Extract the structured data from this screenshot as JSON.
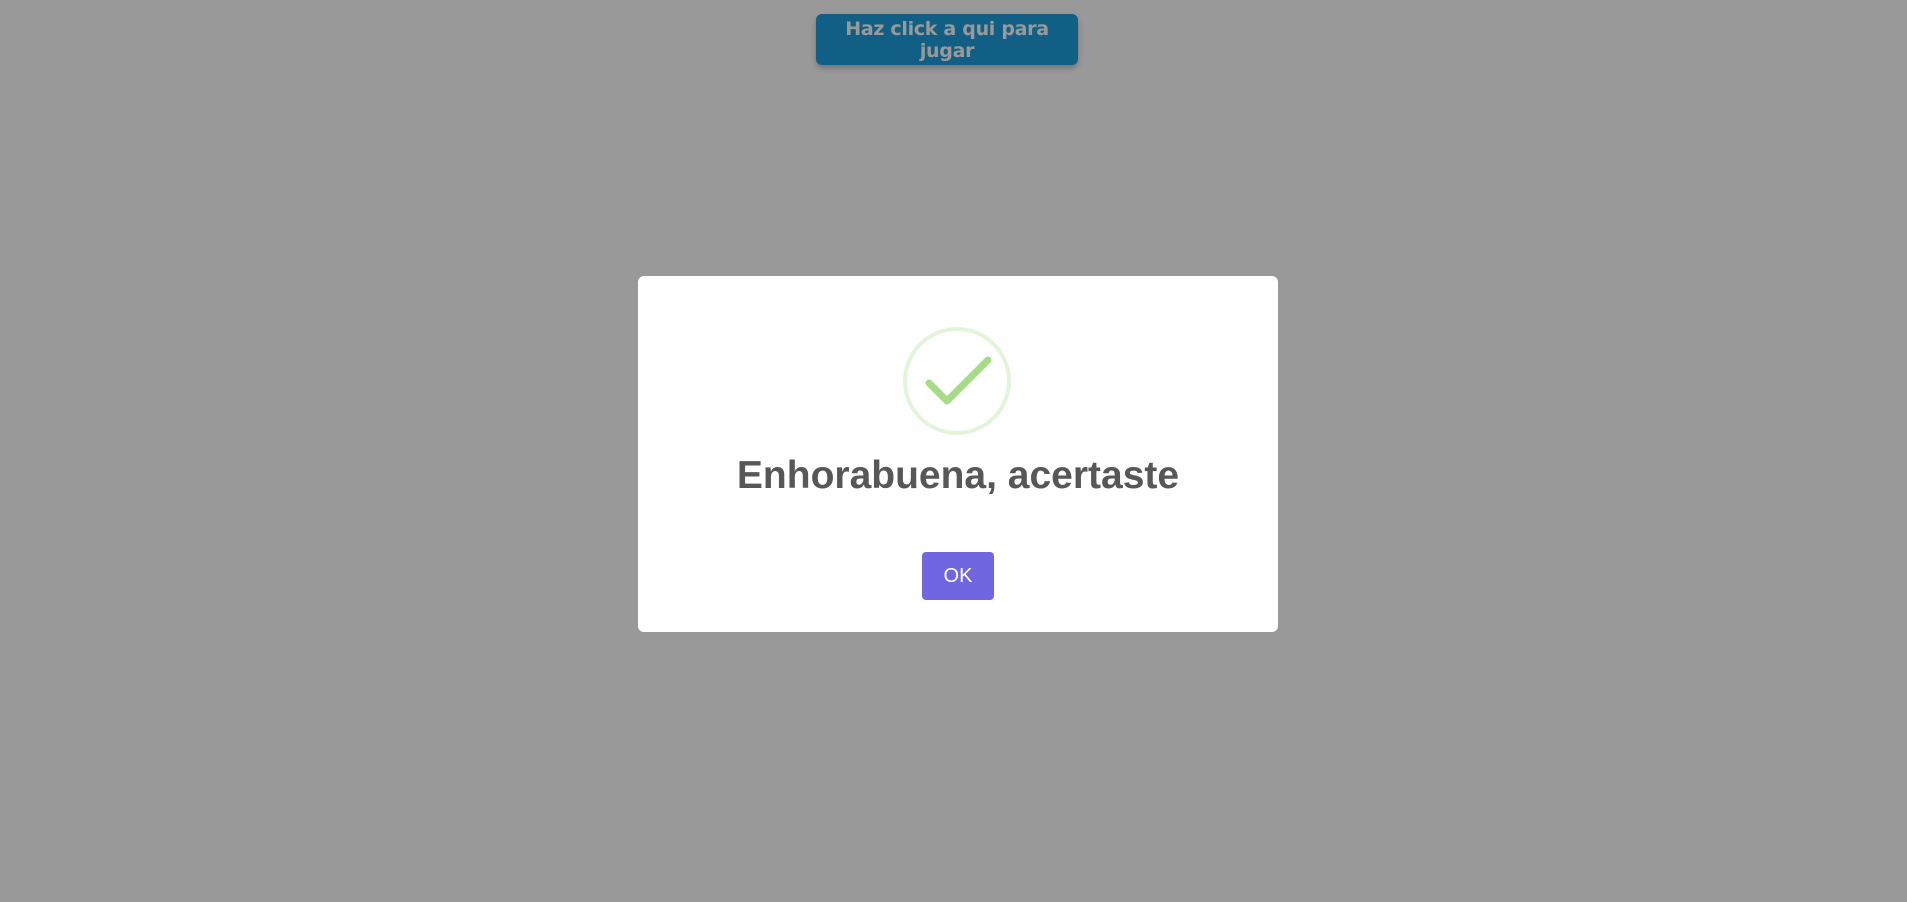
{
  "play_button": {
    "label": "Haz click a qui para jugar",
    "color": "#1e9fe0"
  },
  "dialog": {
    "icon": "check-icon",
    "icon_color": "#a5dc86",
    "title": "Enhorabuena, acertaste",
    "confirm_label": "OK",
    "confirm_color": "#7066e0"
  }
}
